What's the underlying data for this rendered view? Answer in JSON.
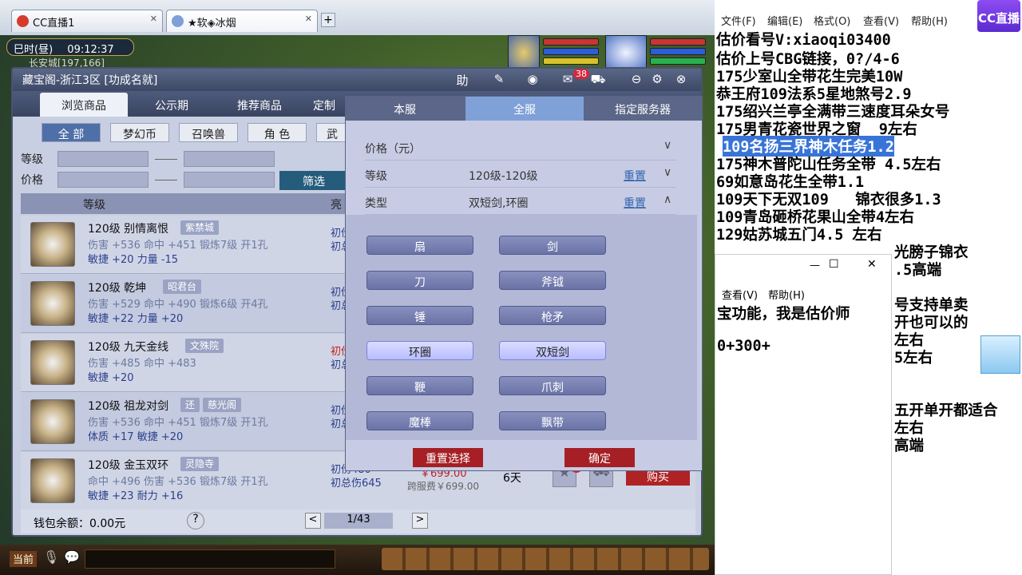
{
  "browser": {
    "tabs": [
      "CC直播1",
      "★软◈冰烟"
    ],
    "add_tab": "+"
  },
  "game": {
    "time_label": "巳时(昼)",
    "clock": "09:12:37",
    "location": "长安城[197,166]",
    "bottom_left": "当前"
  },
  "window": {
    "title": "藏宝阁-浙江3区 [功成名就]",
    "help_label": "助",
    "mail_badge": "38",
    "tabs": [
      "浏览商品",
      "公示期",
      "推荐商品",
      "定制"
    ],
    "categories": [
      "全 部",
      "梦幻币",
      "召唤兽",
      "角 色",
      "武"
    ],
    "filter_level_label": "等级",
    "filter_price_label": "价格",
    "screen_button": "筛选",
    "list_header_level": "等级",
    "list_header_attr": "亮",
    "items": [
      {
        "name": "120级 别情离恨",
        "store": "紫禁城",
        "l2": "伤害 +536 命中 +451 锻炼7级 开1孔",
        "l3": "敏捷 +20 力量 -15",
        "d1": "初伤",
        "d2": "初总伤"
      },
      {
        "name": "120级 乾坤",
        "store": "昭君台",
        "l2": "伤害 +529 命中 +490 锻炼6级 开4孔",
        "l3": "敏捷 +22 力量 +20",
        "d1": "初伤",
        "d2": "初总伤"
      },
      {
        "name": "120级 九天金线",
        "store": "文殊院",
        "l2": "伤害 +485 命中 +483",
        "l3": "敏捷 +20",
        "d1": "初伤",
        "d2": "初总伤"
      },
      {
        "name": "120级 祖龙对剑",
        "tag": "还",
        "store": "慈光阁",
        "l2": "伤害 +536 命中 +451 锻炼7级 开1孔",
        "l3": "体质 +17 敏捷 +20",
        "d1": "初伤",
        "d2": "初总伤"
      },
      {
        "name": "120级 金玉双环",
        "store": "灵隐寺",
        "l2": "命中 +496 伤害 +536 锻炼7级 开1孔",
        "l3": "敏捷 +23 耐力 +16",
        "d1": "初伤480",
        "d2": "初总伤645",
        "price": "￥699.00",
        "price2": "跨服费￥699.00",
        "days": "6天",
        "fav": "2",
        "buy": "购买"
      }
    ],
    "wallet": "钱包余额：0.00元",
    "help_q": "?",
    "page": "1/43",
    "prev": "<",
    "next": ">"
  },
  "dropdown": {
    "tabs": [
      "本服",
      "全服",
      "指定服务器"
    ],
    "price_label": "价格（元）",
    "level_label": "等级",
    "level_value": "120级-120级",
    "type_label": "类型",
    "type_value": "双短剑,环圈",
    "reset": "重置",
    "options": [
      "扇",
      "剑",
      "刀",
      "斧钺",
      "锤",
      "枪矛",
      "环圈",
      "双短剑",
      "鞭",
      "爪刺",
      "魔棒",
      "飘带"
    ],
    "selected": [
      "环圈",
      "双短剑"
    ],
    "reset_select": "重置选择",
    "confirm": "确定"
  },
  "notepad": {
    "menu": [
      "文件(F)",
      "编辑(E)",
      "格式(O)",
      "查看(V)",
      "帮助(H)"
    ],
    "lines": [
      "估价看号V:xiaoqi03400",
      "估价上号CBG链接，0?/4-6",
      "175少室山全带花生完美10W",
      "恭王府109法系5星地煞号2.9",
      "175绍兴兰亭全满带三速度耳朵女号",
      "175男青花瓷世界之窗  9左右",
      "109名扬三界神木任务1.2",
      "175神木普陀山任务全带 4.5左右",
      "69如意岛花生全带1.1",
      "109天下无双109   锦衣很多1.3",
      "109青岛砸桥花果山全带4左右",
      "129姑苏城五门4.5 左右"
    ],
    "highlight_line": "109名扬三界神木任务1.2",
    "partial_lines": [
      "光膀子锦衣",
      ".5高端",
      "号支持单卖",
      "开也可以的",
      "左右",
      "5左右",
      "五开单开都适合",
      "左右",
      "高端"
    ],
    "second_menu": [
      "查看(V)",
      "帮助(H)"
    ],
    "second_lines": [
      "宝功能，我是估价师",
      "0+300+"
    ],
    "cc_logo": "CC直播"
  }
}
